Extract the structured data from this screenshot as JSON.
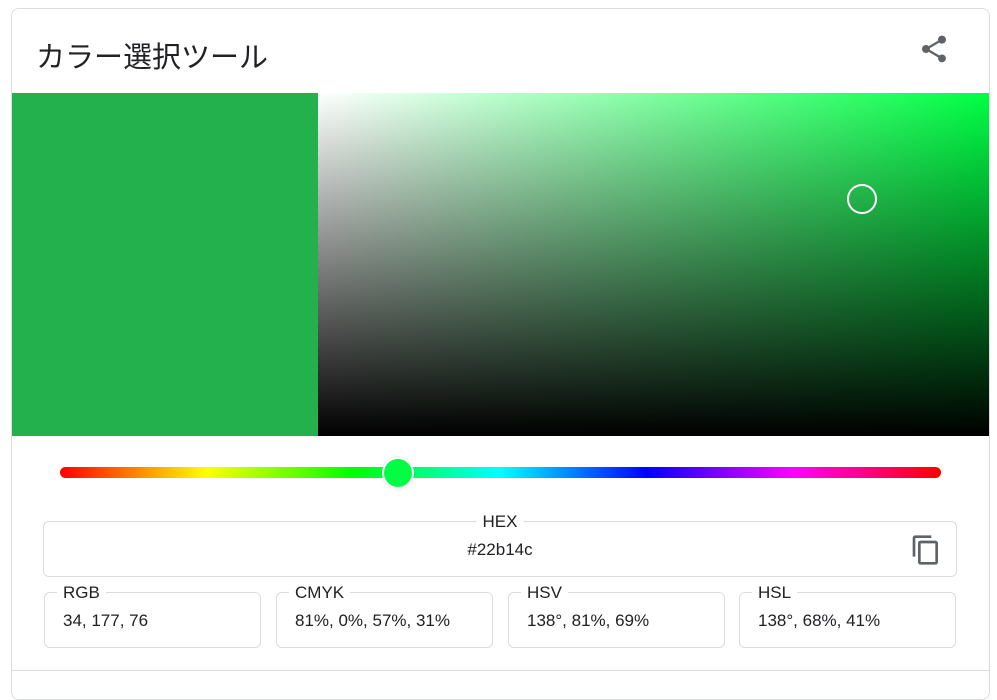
{
  "title": "カラー選択ツール",
  "icons": {
    "share": "share-icon",
    "copy": "copy-icon"
  },
  "selected_color": "#22b14c",
  "hue_color": "#00ff44",
  "picker": {
    "saturation": 0.81,
    "value": 0.69,
    "hue_degrees": 138
  },
  "hex": {
    "label": "HEX",
    "value": "#22b14c"
  },
  "formats": [
    {
      "label": "RGB",
      "value": "34, 177, 76"
    },
    {
      "label": "CMYK",
      "value": "81%, 0%, 57%, 31%"
    },
    {
      "label": "HSV",
      "value": "138°, 81%, 69%"
    },
    {
      "label": "HSL",
      "value": "138°, 68%, 41%"
    }
  ]
}
